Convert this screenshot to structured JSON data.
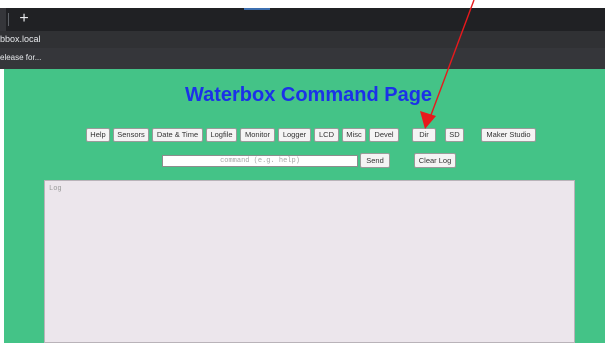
{
  "browser": {
    "new_tab_symbol": "+",
    "address": "bbox.local",
    "bookmark": "elease for...",
    "accent_color": "#3c6fb0"
  },
  "page": {
    "title": "Waterbox Command Page",
    "background_color": "#44c387",
    "title_color": "#1b31e8",
    "buttons": [
      "Help",
      "Sensors",
      "Date & Time",
      "Logfile",
      "Monitor",
      "Logger",
      "LCD",
      "Misc",
      "Devel",
      "Dir",
      "SD",
      "Maker Studio"
    ],
    "command": {
      "value": "",
      "placeholder": "command (e.g. help)"
    },
    "send_label": "Send",
    "clear_log_label": "Clear Log",
    "log": {
      "placeholder": "Log"
    }
  },
  "annotation": {
    "type": "arrow",
    "color": "#e8191c",
    "points_to": "Dir"
  }
}
